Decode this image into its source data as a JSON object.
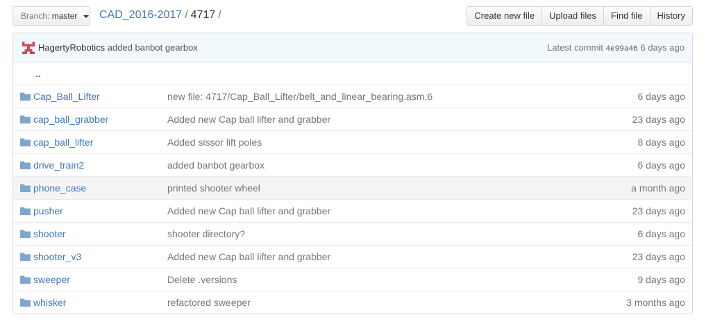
{
  "branch": {
    "prefix": "Branch:",
    "name": "master"
  },
  "breadcrumb": {
    "repo": "CAD_2016-2017",
    "sep1": "/",
    "folder": "4717",
    "sep2": "/"
  },
  "actions": {
    "create_new_file": "Create new file",
    "upload_files": "Upload files",
    "find_file": "Find file",
    "history": "History"
  },
  "commit": {
    "author": "HagertyRobotics",
    "message": "added banbot gearbox",
    "latest_label": "Latest commit",
    "sha": "4e99a46",
    "age": "6 days ago"
  },
  "parent_dir": "..",
  "files": [
    {
      "name": "Cap_Ball_Lifter",
      "message": "new file: 4717/Cap_Ball_Lifter/belt_and_linear_bearing.asm.6",
      "age": "6 days ago"
    },
    {
      "name": "cap_ball_grabber",
      "message": "Added new Cap ball lifter and grabber",
      "age": "23 days ago"
    },
    {
      "name": "cap_ball_lifter",
      "message": "Added sissor lift poles",
      "age": "8 days ago"
    },
    {
      "name": "drive_train2",
      "message": "added banbot gearbox",
      "age": "6 days ago"
    },
    {
      "name": "phone_case",
      "message": "printed shooter wheel",
      "age": "a month ago"
    },
    {
      "name": "pusher",
      "message": "Added new Cap ball lifter and grabber",
      "age": "23 days ago"
    },
    {
      "name": "shooter",
      "message": "shooter directory?",
      "age": "6 days ago"
    },
    {
      "name": "shooter_v3",
      "message": "Added new Cap ball lifter and grabber",
      "age": "23 days ago"
    },
    {
      "name": "sweeper",
      "message": "Delete .versions",
      "age": "9 days ago"
    },
    {
      "name": "whisker",
      "message": "refactored sweeper",
      "age": "3 months ago"
    }
  ],
  "colors": {
    "link": "#4078c0",
    "muted": "#767676",
    "commit_bg": "#f2f9fc",
    "folder": "#80a6cd",
    "hover_row": "#f5f5f5"
  },
  "icons": {
    "folder": "folder-icon",
    "avatar": "avatar-identicon",
    "caret": "caret-down-icon"
  }
}
